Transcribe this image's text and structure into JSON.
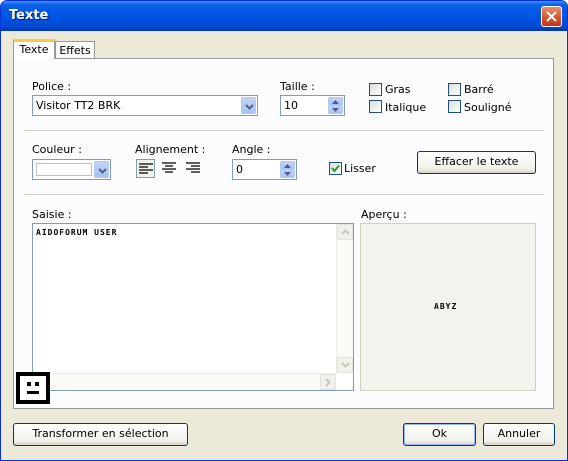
{
  "window": {
    "title": "Texte"
  },
  "tabs": [
    {
      "label": "Texte",
      "active": true
    },
    {
      "label": "Effets",
      "active": false
    }
  ],
  "font": {
    "label": "Police :",
    "value": "Visitor TT2 BRK"
  },
  "size": {
    "label": "Taille :",
    "value": "10"
  },
  "style_options": [
    {
      "label": "Gras",
      "checked": false
    },
    {
      "label": "Barré",
      "checked": false
    },
    {
      "label": "Italique",
      "checked": false
    },
    {
      "label": "Souligné",
      "checked": false
    }
  ],
  "color": {
    "label": "Couleur :",
    "value": "#ffffff"
  },
  "alignment": {
    "label": "Alignement :",
    "selected": "left",
    "icons": [
      "align-left-icon",
      "align-center-icon",
      "align-right-icon"
    ]
  },
  "angle": {
    "label": "Angle :",
    "value": "0"
  },
  "smooth": {
    "label": "Lisser",
    "checked": true
  },
  "clear_button": "Effacer le texte",
  "input": {
    "label": "Saisie :",
    "value": "AIDOFORUM USER"
  },
  "preview": {
    "label": "Aperçu :",
    "sample": "ABYZ"
  },
  "buttons": {
    "transform": "Transformer en sélection",
    "ok": "Ok",
    "cancel": "Annuler"
  },
  "colors": {
    "titlebar": "#0055e5",
    "dialog_bg": "#ece9d8",
    "panel_bg": "#fcfcfe",
    "tab_highlight": "#ffc83c",
    "check": "#21a121"
  }
}
